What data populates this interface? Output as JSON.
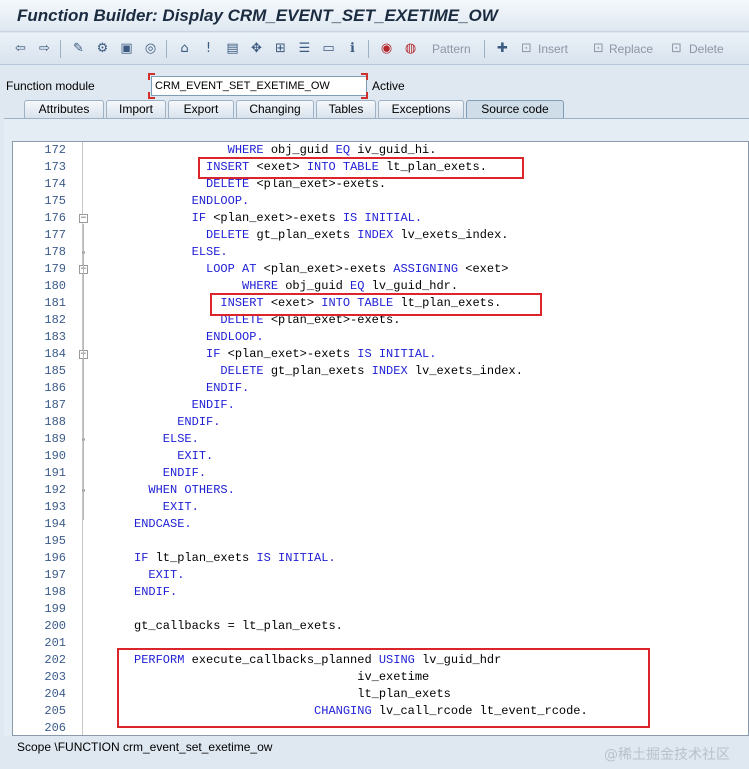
{
  "window": {
    "title": "Function Builder: Display CRM_EVENT_SET_EXETIME_OW"
  },
  "toolbar": {
    "icons": [
      "back-arrow-icon",
      "forward-arrow-icon",
      "edit-toggle-icon",
      "other-object-icon",
      "activate-icon",
      "check-icon",
      "where-used-icon",
      "object-list-icon",
      "navigation-window-icon",
      "enhance-icon",
      "test-icon",
      "tree-icon",
      "display-object-list-icon",
      "info-icon",
      "pretty-printer-icon",
      "help-icon",
      "insert-pattern-icon"
    ],
    "pattern_label": "Pattern",
    "insert_label": "Insert",
    "replace_label": "Replace",
    "delete_label": "Delete"
  },
  "header": {
    "function_module_label": "Function module",
    "function_module_value": "CRM_EVENT_SET_EXETIME_OW",
    "status": "Active"
  },
  "tabs": [
    {
      "label": "Attributes"
    },
    {
      "label": "Import"
    },
    {
      "label": "Export"
    },
    {
      "label": "Changing"
    },
    {
      "label": "Tables"
    },
    {
      "label": "Exceptions"
    },
    {
      "label": "Source code"
    }
  ],
  "code": {
    "lines": [
      {
        "n": "172",
        "t": [
          [
            "kw",
            "                  WHERE "
          ],
          [
            "tx",
            "obj_guid "
          ],
          [
            "kw",
            "EQ "
          ],
          [
            "tx",
            "iv_guid_hi."
          ]
        ]
      },
      {
        "n": "173",
        "t": [
          [
            "kw",
            "               INSERT "
          ],
          [
            "tx",
            "<exet> "
          ],
          [
            "kw",
            "INTO TABLE "
          ],
          [
            "tx",
            "lt_plan_exets."
          ]
        ]
      },
      {
        "n": "174",
        "t": [
          [
            "kw",
            "               DELETE "
          ],
          [
            "tx",
            "<plan_exet>-exets."
          ]
        ]
      },
      {
        "n": "175",
        "t": [
          [
            "kw",
            "             ENDLOOP."
          ]
        ]
      },
      {
        "n": "176",
        "t": [
          [
            "kw",
            "             IF "
          ],
          [
            "tx",
            "<plan_exet>-exets "
          ],
          [
            "kw",
            "IS INITIAL."
          ]
        ]
      },
      {
        "n": "177",
        "t": [
          [
            "kw",
            "               DELETE "
          ],
          [
            "tx",
            "gt_plan_exets "
          ],
          [
            "kw",
            "INDEX "
          ],
          [
            "tx",
            "lv_exets_index."
          ]
        ]
      },
      {
        "n": "178",
        "t": [
          [
            "kw",
            "             ELSE."
          ]
        ]
      },
      {
        "n": "179",
        "t": [
          [
            "kw",
            "               LOOP AT "
          ],
          [
            "tx",
            "<plan_exet>-exets "
          ],
          [
            "kw",
            "ASSIGNING "
          ],
          [
            "tx",
            "<exet>"
          ]
        ]
      },
      {
        "n": "180",
        "t": [
          [
            "kw",
            "                    WHERE "
          ],
          [
            "tx",
            "obj_guid "
          ],
          [
            "kw",
            "EQ "
          ],
          [
            "tx",
            "lv_guid_hdr."
          ]
        ]
      },
      {
        "n": "181",
        "t": [
          [
            "kw",
            "                 INSERT "
          ],
          [
            "tx",
            "<exet> "
          ],
          [
            "kw",
            "INTO TABLE "
          ],
          [
            "tx",
            "lt_plan_exets."
          ]
        ]
      },
      {
        "n": "182",
        "t": [
          [
            "kw",
            "                 DELETE "
          ],
          [
            "tx",
            "<plan_exet>-exets."
          ]
        ]
      },
      {
        "n": "183",
        "t": [
          [
            "kw",
            "               ENDLOOP."
          ]
        ]
      },
      {
        "n": "184",
        "t": [
          [
            "kw",
            "               IF "
          ],
          [
            "tx",
            "<plan_exet>-exets "
          ],
          [
            "kw",
            "IS INITIAL."
          ]
        ]
      },
      {
        "n": "185",
        "t": [
          [
            "kw",
            "                 DELETE "
          ],
          [
            "tx",
            "gt_plan_exets "
          ],
          [
            "kw",
            "INDEX "
          ],
          [
            "tx",
            "lv_exets_index."
          ]
        ]
      },
      {
        "n": "186",
        "t": [
          [
            "kw",
            "               ENDIF."
          ]
        ]
      },
      {
        "n": "187",
        "t": [
          [
            "kw",
            "             ENDIF."
          ]
        ]
      },
      {
        "n": "188",
        "t": [
          [
            "kw",
            "           ENDIF."
          ]
        ]
      },
      {
        "n": "189",
        "t": [
          [
            "kw",
            "         ELSE."
          ]
        ]
      },
      {
        "n": "190",
        "t": [
          [
            "kw",
            "           EXIT."
          ]
        ]
      },
      {
        "n": "191",
        "t": [
          [
            "kw",
            "         ENDIF."
          ]
        ]
      },
      {
        "n": "192",
        "t": [
          [
            "kw",
            "       WHEN OTHERS."
          ]
        ]
      },
      {
        "n": "193",
        "t": [
          [
            "kw",
            "         EXIT."
          ]
        ]
      },
      {
        "n": "194",
        "t": [
          [
            "kw",
            "     ENDCASE."
          ]
        ]
      },
      {
        "n": "195",
        "t": []
      },
      {
        "n": "196",
        "t": [
          [
            "kw",
            "     IF "
          ],
          [
            "tx",
            "lt_plan_exets "
          ],
          [
            "kw",
            "IS INITIAL."
          ]
        ]
      },
      {
        "n": "197",
        "t": [
          [
            "kw",
            "       EXIT."
          ]
        ]
      },
      {
        "n": "198",
        "t": [
          [
            "kw",
            "     ENDIF."
          ]
        ]
      },
      {
        "n": "199",
        "t": []
      },
      {
        "n": "200",
        "t": [
          [
            "tx",
            "     gt_callbacks = lt_plan_exets."
          ]
        ]
      },
      {
        "n": "201",
        "t": []
      },
      {
        "n": "202",
        "t": [
          [
            "kw",
            "     PERFORM "
          ],
          [
            "tx",
            "execute_callbacks_planned "
          ],
          [
            "kw",
            "USING "
          ],
          [
            "tx",
            "lv_guid_hdr"
          ]
        ]
      },
      {
        "n": "203",
        "t": [
          [
            "tx",
            "                                    iv_exetime"
          ]
        ]
      },
      {
        "n": "204",
        "t": [
          [
            "tx",
            "                                    lt_plan_exets"
          ]
        ]
      },
      {
        "n": "205",
        "t": [
          [
            "kw",
            "                              CHANGING "
          ],
          [
            "tx",
            "lv_call_rcode lt_event_rcode."
          ]
        ]
      },
      {
        "n": "206",
        "t": []
      }
    ]
  },
  "status": {
    "scope": "Scope \\FUNCTION crm_event_set_exetime_ow",
    "watermark": "@稀土掘金技术社区"
  }
}
